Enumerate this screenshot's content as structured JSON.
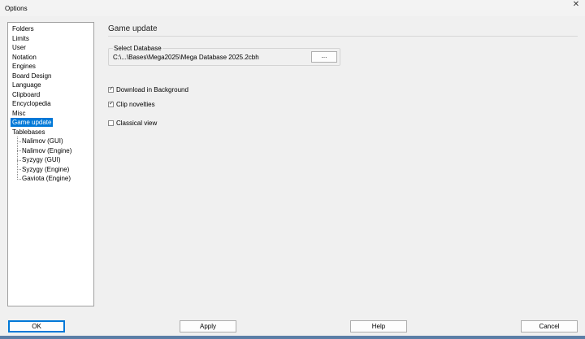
{
  "window": {
    "title": "Options",
    "close_icon": "close-icon"
  },
  "tree": {
    "items": [
      {
        "label": "Folders"
      },
      {
        "label": "Limits"
      },
      {
        "label": "User"
      },
      {
        "label": "Notation"
      },
      {
        "label": "Engines"
      },
      {
        "label": "Board Design"
      },
      {
        "label": "Language"
      },
      {
        "label": "Clipboard"
      },
      {
        "label": "Encyclopedia"
      },
      {
        "label": "Misc"
      },
      {
        "label": "Game update",
        "selected": true
      },
      {
        "label": "Tablebases"
      }
    ],
    "children": [
      {
        "label": "Nalimov (GUI)"
      },
      {
        "label": "Nalimov (Engine)"
      },
      {
        "label": "Syzygy (GUI)"
      },
      {
        "label": "Syzygy (Engine)"
      },
      {
        "label": "Gaviota (Engine)"
      }
    ]
  },
  "page": {
    "title": "Game update",
    "database": {
      "legend": "Select Database",
      "path": "C:\\...\\Bases\\Mega2025\\Mega Database 2025.2cbh",
      "browse_label": "..."
    },
    "options": [
      {
        "label": "Download in Background",
        "checked": true
      },
      {
        "label": "Clip novelties",
        "checked": true
      },
      {
        "label": "Classical view",
        "checked": false
      }
    ]
  },
  "buttons": {
    "ok": "OK",
    "apply": "Apply",
    "help": "Help",
    "cancel": "Cancel"
  },
  "colors": {
    "selection": "#0078d7",
    "background": "#f0f0f0"
  }
}
